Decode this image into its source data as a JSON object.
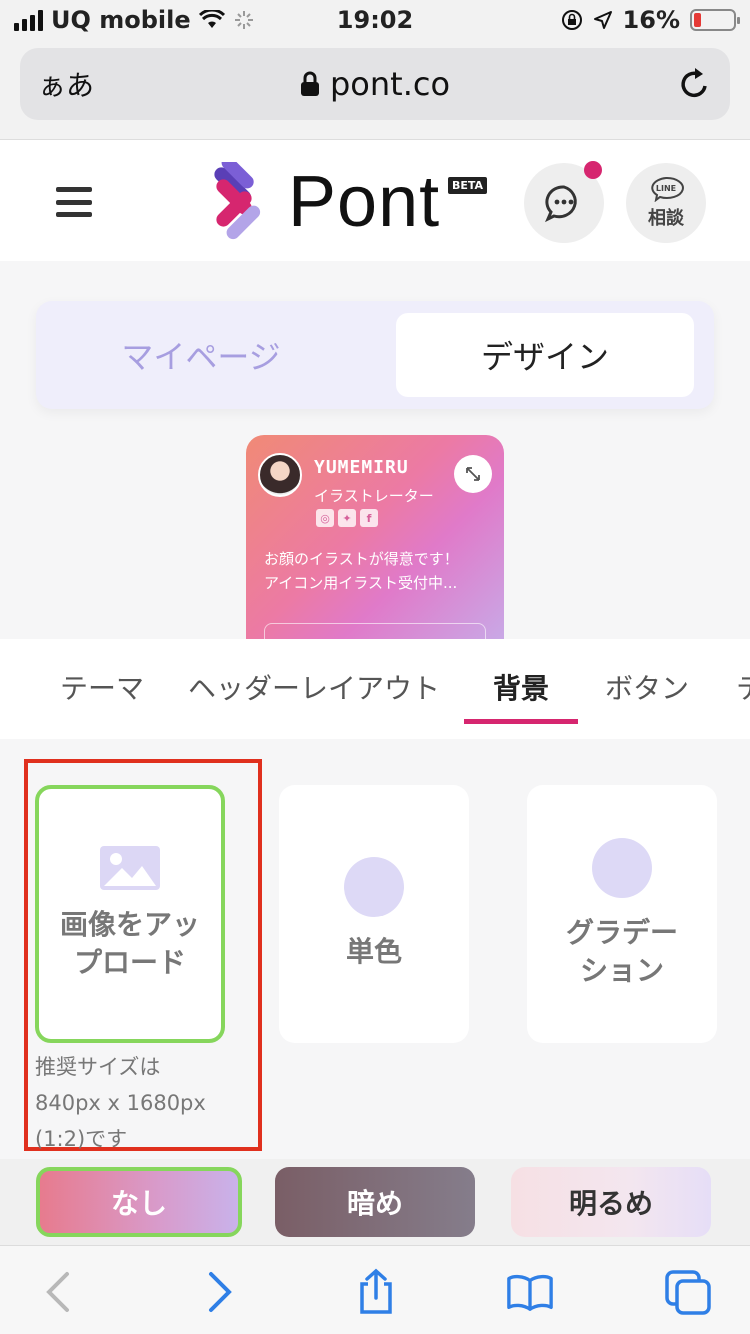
{
  "status_bar": {
    "carrier": "UQ mobile",
    "time": "19:02",
    "battery": "16%",
    "battery_level": 0.16
  },
  "browser": {
    "aa_label": "ぁあ",
    "url": "pont.co"
  },
  "header": {
    "logo_text": "Pont",
    "beta_badge": "BETA",
    "line_icon_text": "LINE",
    "line_label": "相談"
  },
  "segment": {
    "left": "マイページ",
    "right": "デザイン"
  },
  "preview_card": {
    "name": "YUMEMIRU",
    "role": "イラストレーター",
    "bio_line1": "お顔のイラストが得意です！",
    "bio_line2": "アイコン用イラスト受付中..."
  },
  "tabs": {
    "theme": "テーマ",
    "header_layout": "ヘッダーレイアウト",
    "background": "背景",
    "button": "ボタン",
    "next_partial": "テ"
  },
  "background_options": {
    "upload_line1": "画像をアッ",
    "upload_line2": "プロード",
    "solid": "単色",
    "gradient_line1": "グラデー",
    "gradient_line2": "ション",
    "hint_line1": "推奨サイズは",
    "hint_line2": "840px x 1680px",
    "hint_line3": "(1:2)です"
  },
  "overlay": {
    "none": "なし",
    "dark": "暗め",
    "light": "明るめ"
  },
  "colors": {
    "accent": "#d6266f",
    "selected_border": "#86d65c",
    "highlight_frame": "#e0301e",
    "segment_inactive": "#a79ee0"
  }
}
